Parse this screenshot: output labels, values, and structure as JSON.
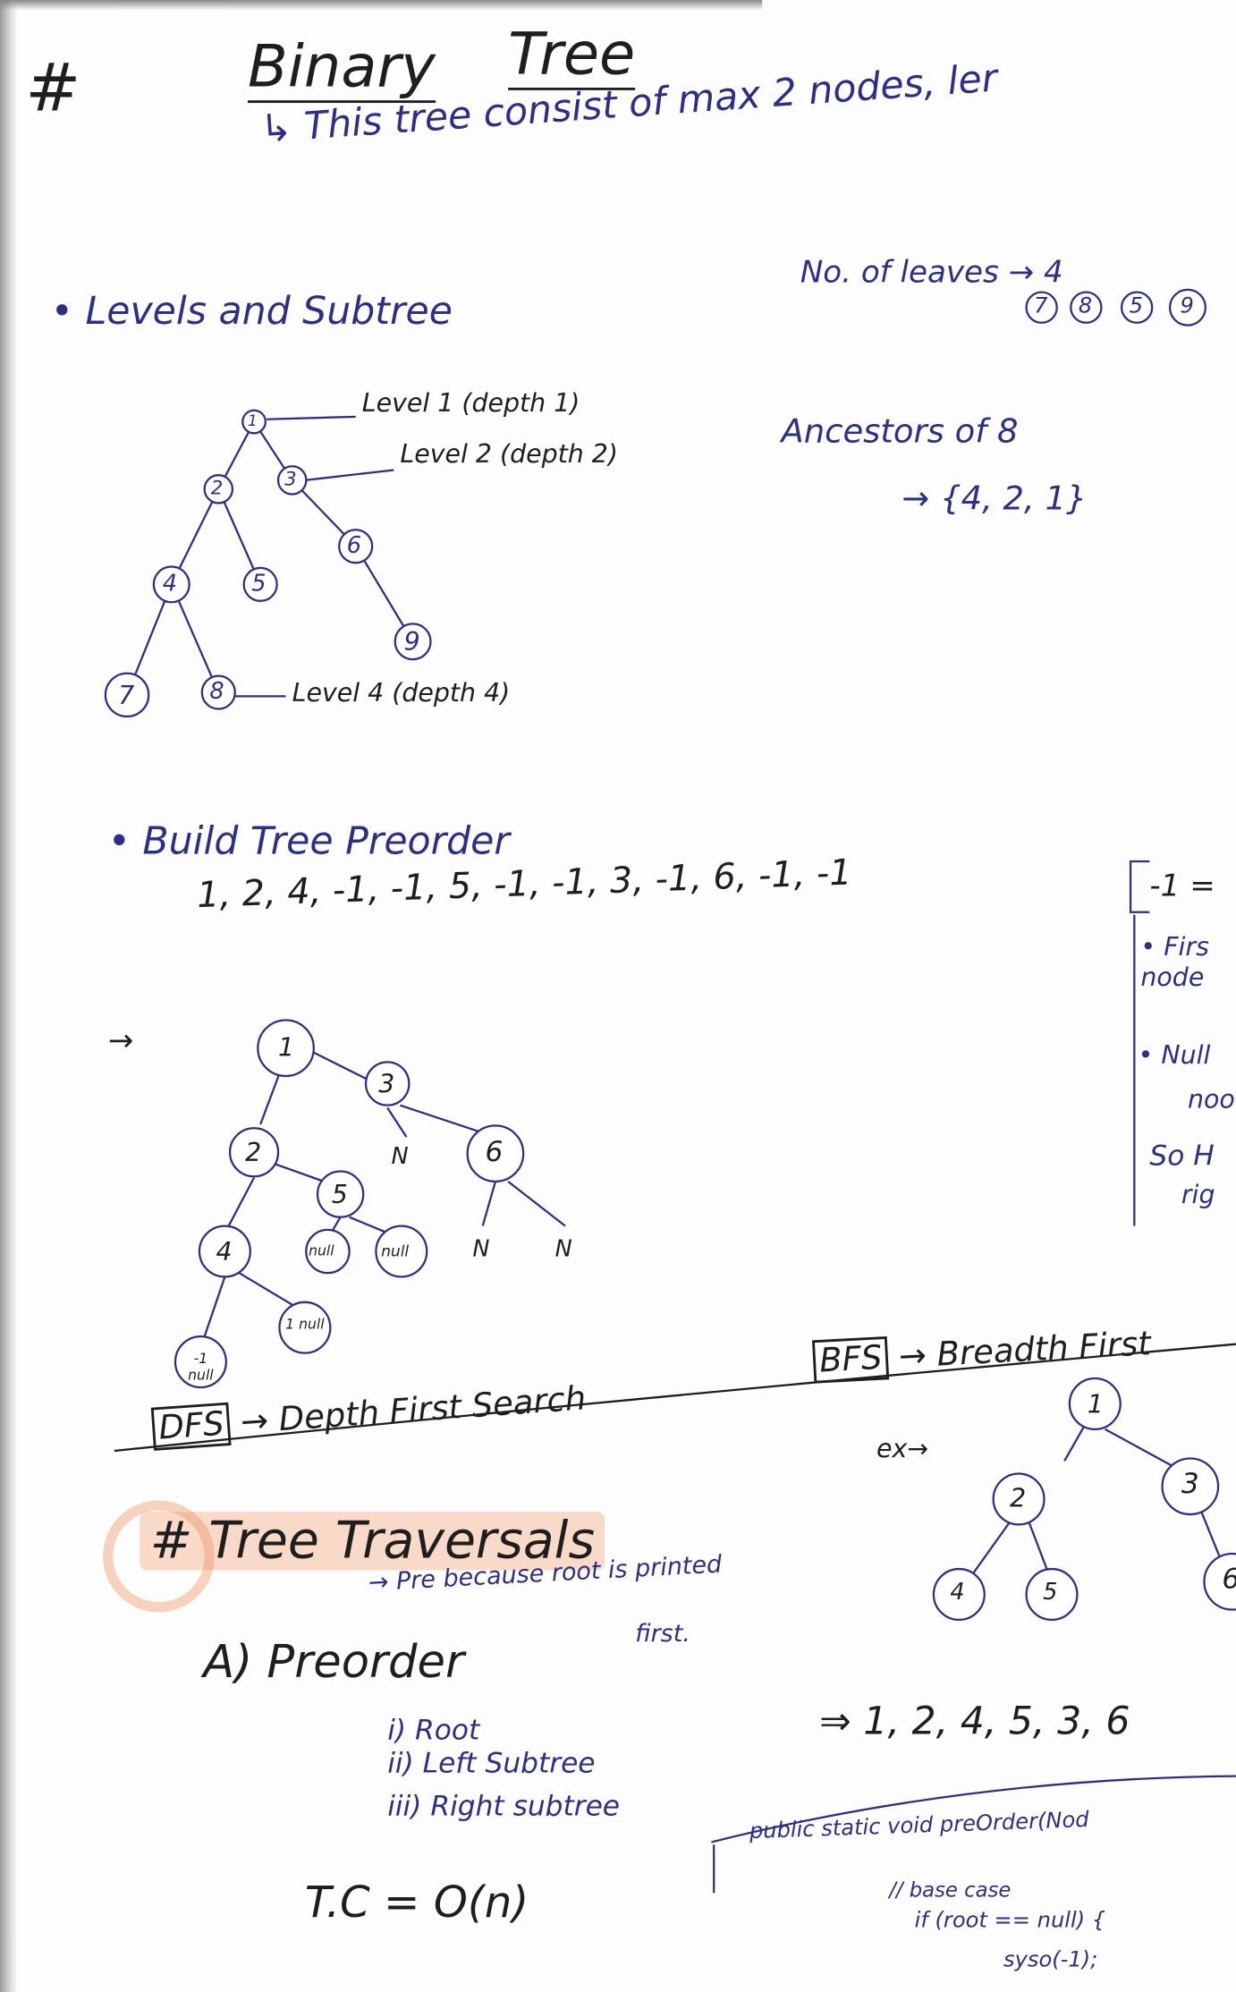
{
  "title": {
    "hash": "#",
    "word1": "Binary",
    "word2": "Tree"
  },
  "definition": "↳ This tree consist of max 2 nodes, ler",
  "levels": {
    "heading": "• Levels and Subtree",
    "level1": "Level 1 (depth 1)",
    "level2": "Level 2 (depth 2)",
    "level4": "Level 4 (depth 4)",
    "leaves_label": "No. of leaves → 4",
    "leaves": [
      "7",
      "8",
      "5",
      "9"
    ],
    "ancestors_label": "Ancestors of 8",
    "ancestors_value": "→ {4, 2, 1}",
    "tree_nodes": [
      "1",
      "2",
      "3",
      "4",
      "5",
      "6",
      "7",
      "8",
      "9"
    ]
  },
  "build": {
    "heading": "• Build Tree Preorder",
    "sequence": "1, 2, 4, -1, -1, 5, -1, -1, 3, -1, 6, -1, -1",
    "arrow": "→",
    "side_note": [
      "-1 =",
      "• Firs",
      "node",
      "• Null",
      "noo",
      "So H",
      "rig"
    ],
    "tree_nodes": [
      "1",
      "3",
      "2",
      "5",
      "6",
      "N",
      "4",
      "null",
      "null",
      "N",
      "N",
      "-1 null",
      "1 null"
    ]
  },
  "bfs": {
    "tag": "BFS",
    "label": "→ Breadth First",
    "example": "ex→",
    "tree_nodes": [
      "1",
      "2",
      "3",
      "4",
      "5",
      "6"
    ]
  },
  "dfs": {
    "tag": "DFS",
    "label": "→ Depth First Search"
  },
  "traversals": {
    "heading": "# Tree Traversals",
    "note_line1": "→ Pre because root is printed",
    "note_line2": "first.",
    "preorder_label": "A) Preorder",
    "steps": [
      "i) Root",
      "ii) Left Subtree",
      "iii) Right subtree"
    ],
    "result": "⇒ 1, 2, 4, 5, 3, 6",
    "complexity": "T.C = O(n)",
    "code": [
      "public static void preOrder(Nod",
      "// base case",
      "if (root == null) {",
      "syso(-1);"
    ]
  },
  "colors": {
    "blue_ink": "#2c2f86",
    "black_ink": "#1e1e1e",
    "highlight": "#f0a070"
  }
}
